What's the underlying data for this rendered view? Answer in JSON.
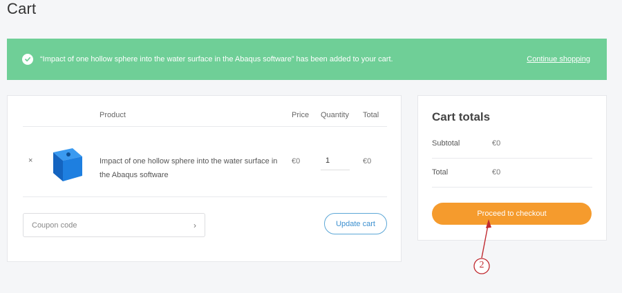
{
  "page": {
    "title": "Cart"
  },
  "notice": {
    "message": "“Impact of one hollow sphere into the water surface in the Abaqus software” has been added to your cart.",
    "continue_label": "Continue shopping",
    "icon": "check-circle-icon",
    "color": "#6fcf97"
  },
  "cart": {
    "headers": {
      "product": "Product",
      "price": "Price",
      "quantity": "Quantity",
      "total": "Total"
    },
    "items": [
      {
        "remove": "×",
        "name": "Impact of one hollow sphere into the water surface in the Abaqus software",
        "price": "€0",
        "quantity": "1",
        "total": "€0",
        "thumb_icon": "blue-cube-icon"
      }
    ],
    "coupon": {
      "placeholder": "Coupon code",
      "arrow": "›"
    },
    "update_label": "Update cart"
  },
  "totals": {
    "title": "Cart totals",
    "subtotal_label": "Subtotal",
    "subtotal_value": "€0",
    "total_label": "Total",
    "total_value": "€0",
    "checkout_label": "Proceed to checkout",
    "accent": "#f59b2d"
  },
  "annotation": {
    "label": "2",
    "color": "#c0292f"
  }
}
